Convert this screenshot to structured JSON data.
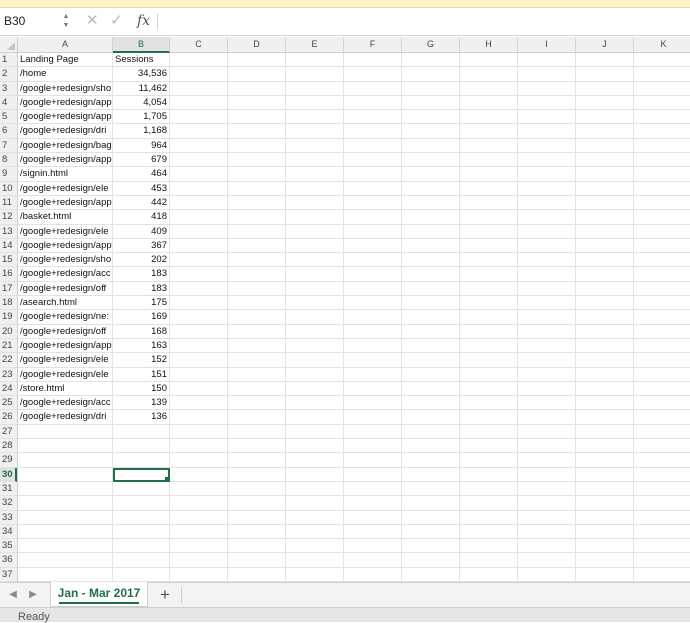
{
  "formula_bar": {
    "name_box": "B30",
    "stepper_up": "▲",
    "stepper_down": "▼",
    "cancel_glyph": "✕",
    "confirm_glyph": "✓",
    "fx_label": "fx",
    "formula": ""
  },
  "grid": {
    "columns": [
      "A",
      "B",
      "C",
      "D",
      "E",
      "F",
      "G",
      "H",
      "I",
      "J",
      "K"
    ],
    "active_column": "B",
    "active_row": "30",
    "selected_cell": "B30",
    "row_numbers": [
      "1",
      "2",
      "3",
      "4",
      "5",
      "6",
      "7",
      "8",
      "9",
      "10",
      "11",
      "12",
      "13",
      "14",
      "15",
      "16",
      "17",
      "18",
      "19",
      "20",
      "21",
      "22",
      "23",
      "24",
      "25",
      "26",
      "27",
      "28",
      "29",
      "30",
      "31",
      "32",
      "33",
      "34",
      "35",
      "36",
      "37"
    ],
    "rows": [
      {
        "a": "Landing Page",
        "b": "Sessions"
      },
      {
        "a": "/home",
        "b": "34,536"
      },
      {
        "a": "/google+redesign/sho",
        "b": "11,462"
      },
      {
        "a": "/google+redesign/app",
        "b": "4,054"
      },
      {
        "a": "/google+redesign/app",
        "b": "1,705"
      },
      {
        "a": "/google+redesign/dri",
        "b": "1,168"
      },
      {
        "a": "/google+redesign/bag",
        "b": "964"
      },
      {
        "a": "/google+redesign/app",
        "b": "679"
      },
      {
        "a": "/signin.html",
        "b": "464"
      },
      {
        "a": "/google+redesign/ele",
        "b": "453"
      },
      {
        "a": "/google+redesign/app",
        "b": "442"
      },
      {
        "a": "/basket.html",
        "b": "418"
      },
      {
        "a": "/google+redesign/ele",
        "b": "409"
      },
      {
        "a": "/google+redesign/app",
        "b": "367"
      },
      {
        "a": "/google+redesign/sho",
        "b": "202"
      },
      {
        "a": "/google+redesign/acc",
        "b": "183"
      },
      {
        "a": "/google+redesign/off",
        "b": "183"
      },
      {
        "a": "/asearch.html",
        "b": "175"
      },
      {
        "a": "/google+redesign/ne:",
        "b": "169"
      },
      {
        "a": "/google+redesign/off",
        "b": "168"
      },
      {
        "a": "/google+redesign/app",
        "b": "163"
      },
      {
        "a": "/google+redesign/ele",
        "b": "152"
      },
      {
        "a": "/google+redesign/ele",
        "b": "151"
      },
      {
        "a": "/store.html",
        "b": "150"
      },
      {
        "a": "/google+redesign/acc",
        "b": "139"
      },
      {
        "a": "/google+redesign/dri",
        "b": "136"
      }
    ]
  },
  "tabs": {
    "prev_glyph": "◀",
    "next_glyph": "▶",
    "sheets": [
      "Jan - Mar 2017"
    ],
    "add_glyph": "+"
  },
  "status": {
    "text": "Ready"
  },
  "colors": {
    "accent": "#1e7145"
  }
}
